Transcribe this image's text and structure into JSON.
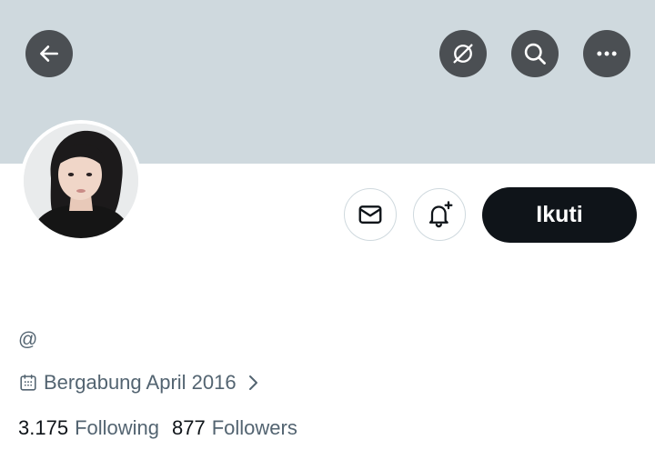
{
  "header": {
    "back_icon": "arrow-left-icon",
    "grok_icon": "grok-icon",
    "search_icon": "search-icon",
    "more_icon": "more-horizontal-icon",
    "banner_color": "#cfd9de",
    "button_color": "#4b4f53"
  },
  "profile": {
    "handle_prefix": "@",
    "joined_text": "Bergabung April 2016",
    "following_count": "3.175",
    "following_label": "Following",
    "followers_count": "877",
    "followers_label": "Followers"
  },
  "actions": {
    "message_icon": "mail-icon",
    "notify_icon": "bell-plus-icon",
    "follow_label": "Ikuti",
    "follow_color": "#0f1419"
  }
}
